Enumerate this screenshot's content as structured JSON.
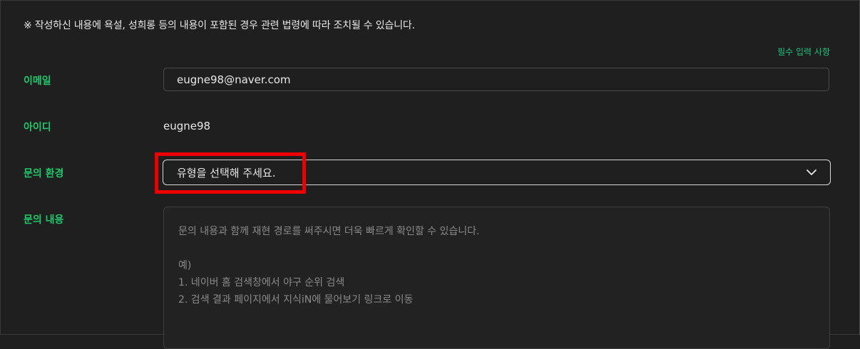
{
  "notice": "※ 작성하신 내용에 욕설, 성희롱 등의 내용이 포함된 경우 관련 법령에 따라 조치될 수 있습니다.",
  "required_note": "필수 입력 사항",
  "form": {
    "email": {
      "label": "이메일",
      "value": "eugne98@naver.com"
    },
    "id": {
      "label": "아이디",
      "value": "eugne98"
    },
    "environment": {
      "label": "문의 환경",
      "selected": "유형을 선택해 주세요.",
      "icon": "chevron-down-icon"
    },
    "content": {
      "label": "문의 내용",
      "placeholder_lines": [
        "문의 내용과 함께 재현 경로를 써주시면 더욱 빠르게 확인할 수 있습니다.",
        "",
        "예)",
        "1. 네이버 홈 검색창에서 야구 순위 검색",
        "2. 검색 결과 페이지에서 지식iN에 물어보기 링크로 이동"
      ]
    }
  },
  "colors": {
    "background": "#1f1f1f",
    "label_green": "#1ec86b",
    "highlight_red": "#ee0000"
  }
}
